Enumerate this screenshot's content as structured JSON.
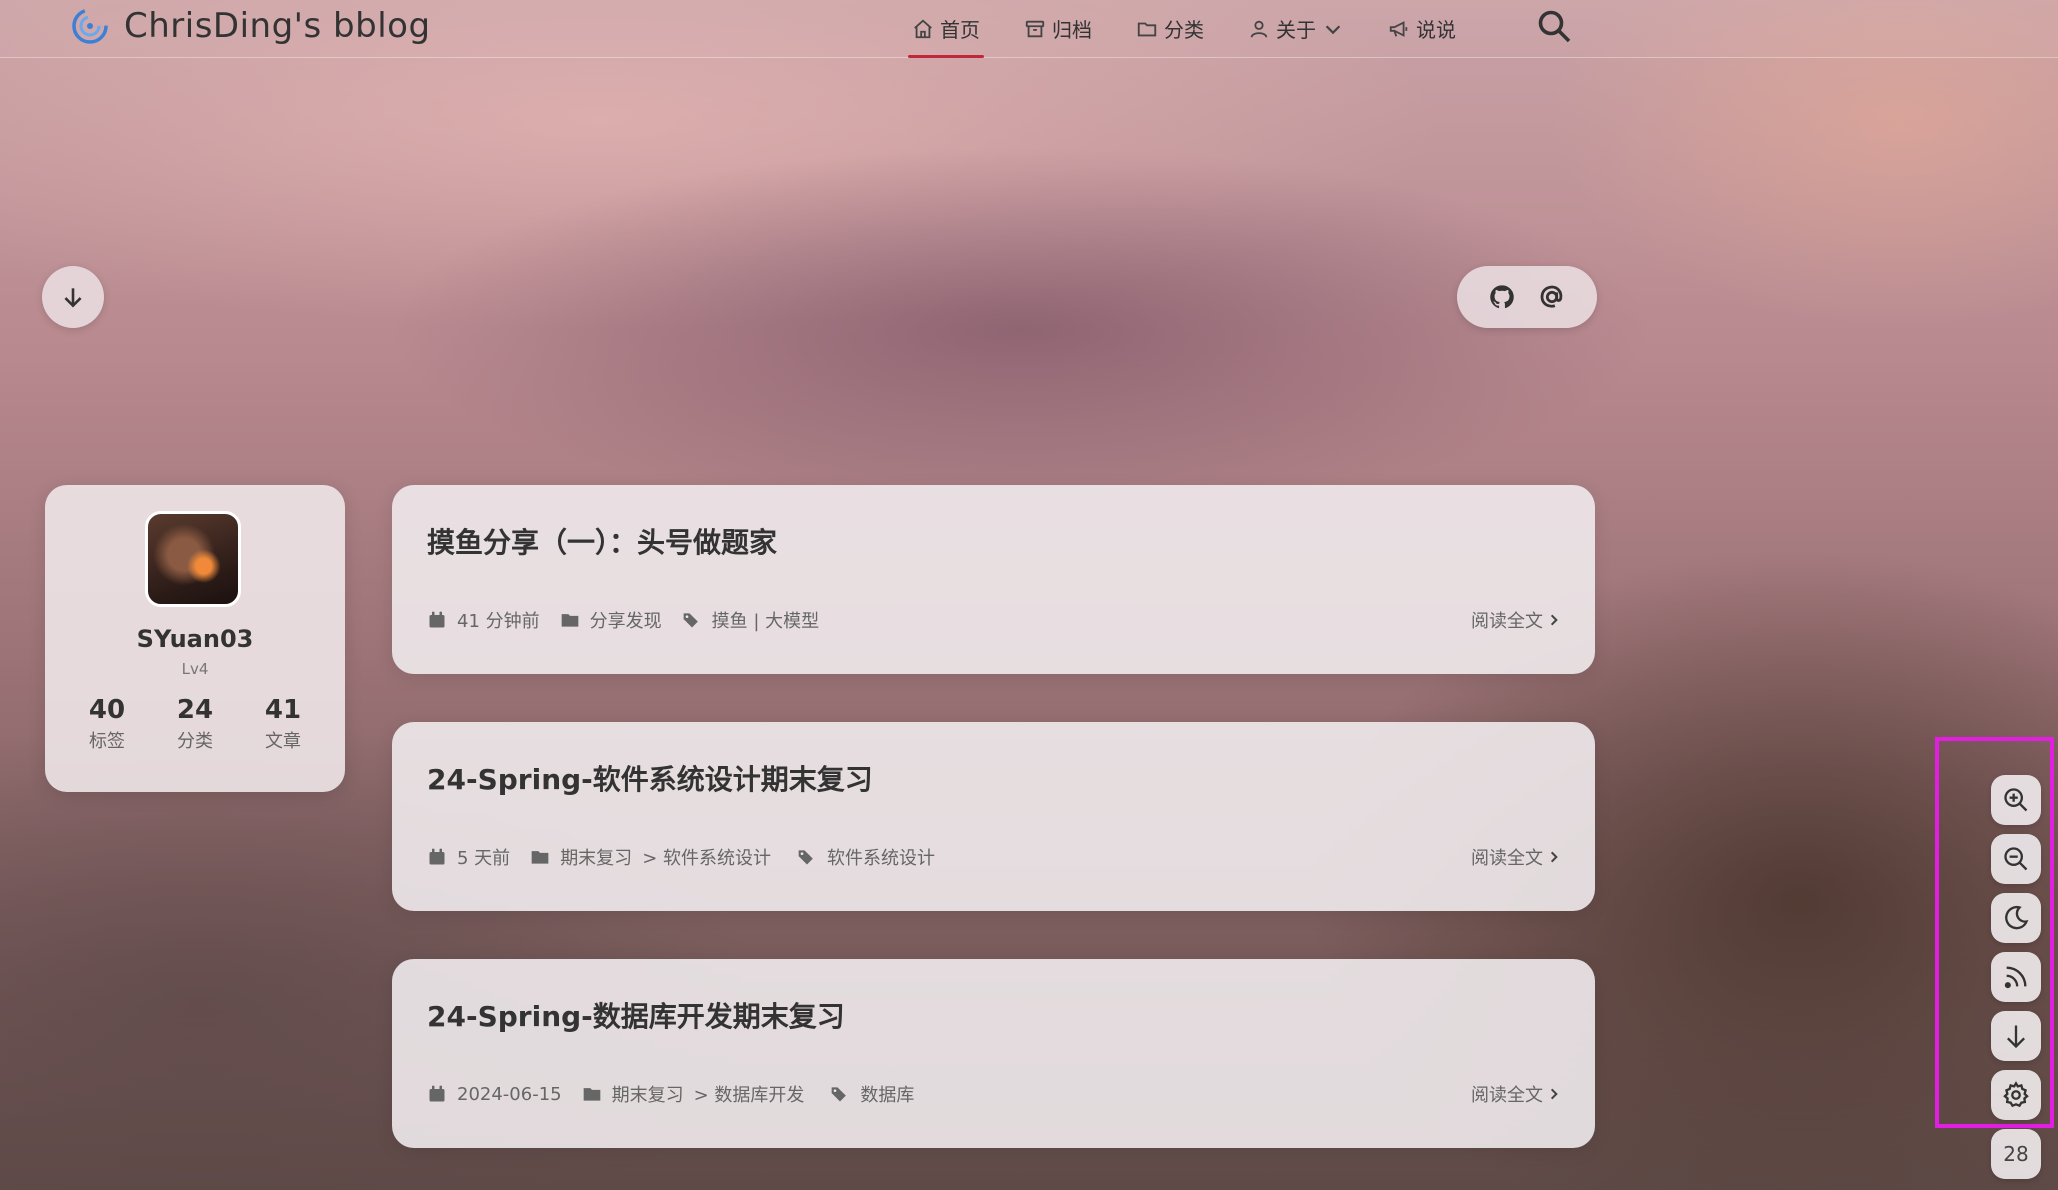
{
  "site": {
    "title": "ChrisDing's bblog"
  },
  "nav": {
    "items": [
      {
        "label": "首页",
        "icon": "home-icon",
        "active": true
      },
      {
        "label": "归档",
        "icon": "archive-icon"
      },
      {
        "label": "分类",
        "icon": "folder-icon"
      },
      {
        "label": "关于",
        "icon": "user-icon",
        "has_dropdown": true
      },
      {
        "label": "说说",
        "icon": "megaphone-icon"
      }
    ],
    "search_icon": "search-icon"
  },
  "social": {
    "links": [
      "github-icon",
      "email-at-icon"
    ]
  },
  "profile": {
    "name": "SYuan03",
    "level": "Lv4",
    "stats": [
      {
        "num": "40",
        "label": "标签"
      },
      {
        "num": "24",
        "label": "分类"
      },
      {
        "num": "41",
        "label": "文章"
      }
    ]
  },
  "posts": [
    {
      "title": "摸鱼分享（一）：头号做题家",
      "date": "41 分钟前",
      "category": "分享发现",
      "category_sub": "",
      "tags": "摸鱼 | 大模型",
      "read_more": "阅读全文"
    },
    {
      "title": "24-Spring-软件系统设计期末复习",
      "date": "5 天前",
      "category": "期末复习",
      "category_sub": "> 软件系统设计",
      "tags": "软件系统设计",
      "read_more": "阅读全文"
    },
    {
      "title": "24-Spring-数据库开发期末复习",
      "date": "2024-06-15",
      "category": "期末复习",
      "category_sub": "> 数据库开发",
      "tags": "数据库",
      "read_more": "阅读全文"
    }
  ],
  "toolbar": {
    "buttons": [
      "zoom-in-icon",
      "zoom-out-icon",
      "moon-icon",
      "rss-icon",
      "arrow-down-icon",
      "gear-icon"
    ],
    "page_number": "28"
  },
  "colors": {
    "accent": "#c0283a",
    "highlight_border": "#e11ee1"
  }
}
